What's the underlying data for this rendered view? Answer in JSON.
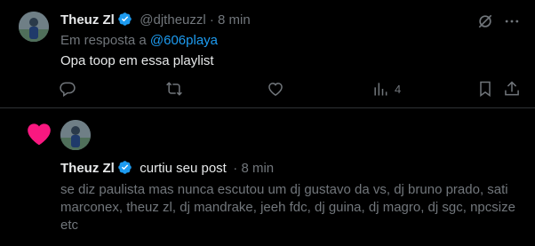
{
  "reply_post": {
    "author_name": "Theuz Zl",
    "handle_time": "@djtheuzzl · 8 min",
    "in_reply_prefix": "Em resposta a",
    "in_reply_handle": "@606playa",
    "text": "Opa toop em essa playlist",
    "views_count": "4"
  },
  "like_notification": {
    "author_name": "Theuz Zl",
    "action": "curtiu seu post",
    "time": "· 8 min",
    "post_text": "se diz paulista mas nunca escutou um dj gustavo da vs, dj bruno prado, sati marconex, theuz zl, dj mandrake, jeeh fdc, dj guina, dj magro, dj sgc, npcsize etc"
  },
  "colors": {
    "background": "#000000",
    "text_primary": "#e7e9ea",
    "text_muted": "#71767b",
    "accent_blue": "#1d9bf0",
    "like_pink": "#f91880",
    "divider": "#2f3336"
  }
}
